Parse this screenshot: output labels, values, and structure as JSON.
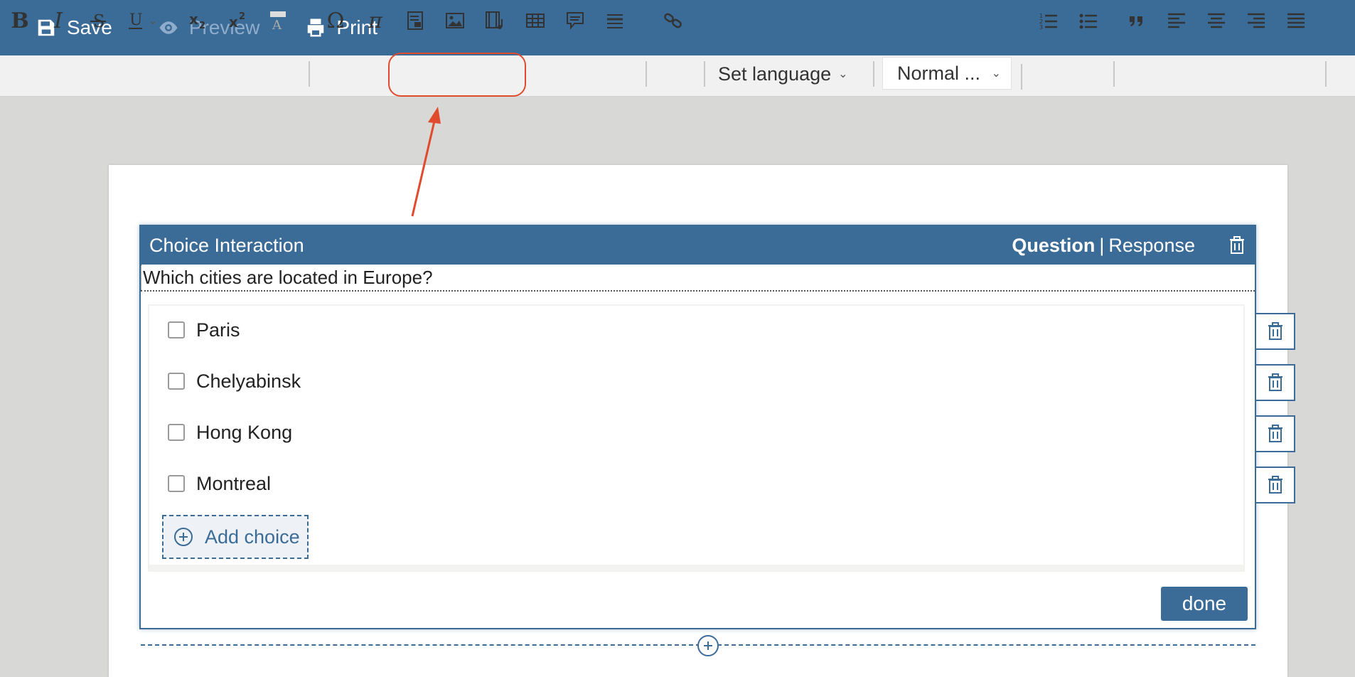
{
  "topbar": {
    "save_label": "Save",
    "preview_label": "Preview",
    "print_label": "Print"
  },
  "toolbar": {
    "bold": "B",
    "italic": "I",
    "omega": "Ω",
    "pi": "π",
    "language_label": "Set language",
    "style_label": "Normal ..."
  },
  "interaction": {
    "title": "Choice Interaction",
    "mode_question": "Question",
    "mode_separator": "|",
    "mode_response": "Response",
    "prompt": "Which cities are located in Europe?",
    "choices": [
      {
        "label": "Paris",
        "checked": false
      },
      {
        "label": "Chelyabinsk",
        "checked": false
      },
      {
        "label": "Hong Kong",
        "checked": false
      },
      {
        "label": "Montreal",
        "checked": false
      }
    ],
    "add_choice_label": "Add choice",
    "done_label": "done"
  },
  "colors": {
    "brand": "#3b6c97",
    "highlight": "#e04b2e",
    "toolbar_bg": "#f1f1f1"
  }
}
